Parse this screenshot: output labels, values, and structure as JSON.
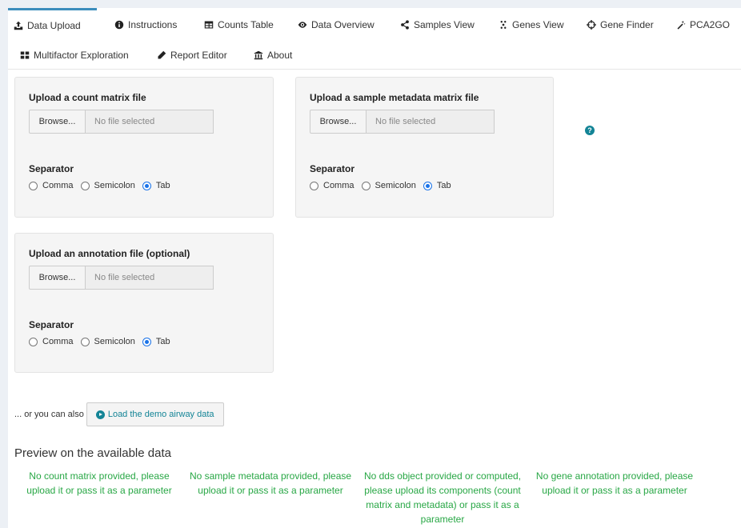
{
  "tabs": [
    {
      "label": "Data Upload",
      "icon": "upload-icon",
      "active": true
    },
    {
      "label": "Instructions",
      "icon": "info-circle-icon",
      "active": false
    },
    {
      "label": "Counts Table",
      "icon": "table-icon",
      "active": false
    },
    {
      "label": "Data Overview",
      "icon": "eye-icon",
      "active": false
    },
    {
      "label": "Samples View",
      "icon": "share-icon",
      "active": false
    },
    {
      "label": "Genes View",
      "icon": "dna-icon",
      "active": false
    },
    {
      "label": "Gene Finder",
      "icon": "crosshairs-icon",
      "active": false
    },
    {
      "label": "PCA2GO",
      "icon": "magic-icon",
      "active": false
    },
    {
      "label": "Multifactor Exploration",
      "icon": "grid-icon",
      "active": false
    },
    {
      "label": "Report Editor",
      "icon": "pencil-icon",
      "active": false
    },
    {
      "label": "About",
      "icon": "institution-icon",
      "active": false
    }
  ],
  "panels": {
    "count": {
      "title": "Upload a count matrix file",
      "browse": "Browse...",
      "file_placeholder": "No file selected",
      "separator_label": "Separator",
      "options": [
        "Comma",
        "Semicolon",
        "Tab"
      ],
      "selected": "Tab"
    },
    "metadata": {
      "title": "Upload a sample metadata matrix file",
      "browse": "Browse...",
      "file_placeholder": "No file selected",
      "separator_label": "Separator",
      "options": [
        "Comma",
        "Semicolon",
        "Tab"
      ],
      "selected": "Tab"
    },
    "annotation": {
      "title": "Upload an annotation file (optional)",
      "browse": "Browse...",
      "file_placeholder": "No file selected",
      "separator_label": "Separator",
      "options": [
        "Comma",
        "Semicolon",
        "Tab"
      ],
      "selected": "Tab"
    }
  },
  "help_icon": "?",
  "demo": {
    "prefix": "... or you can also",
    "button_label": "Load the demo airway data"
  },
  "preview": {
    "title": "Preview on the available data",
    "messages": [
      "No count matrix provided, please upload it or pass it as a parameter",
      "No sample metadata provided, please upload it or pass it as a parameter",
      "No dds object provided or computed, please upload its components (count matrix and metadata) or pass it as a parameter",
      "No gene annotation provided, please upload it or pass it as a parameter"
    ]
  },
  "colors": {
    "accent": "#3c8dbc",
    "teal": "#138496",
    "success": "#28a745",
    "radio": "#1a73e8"
  }
}
